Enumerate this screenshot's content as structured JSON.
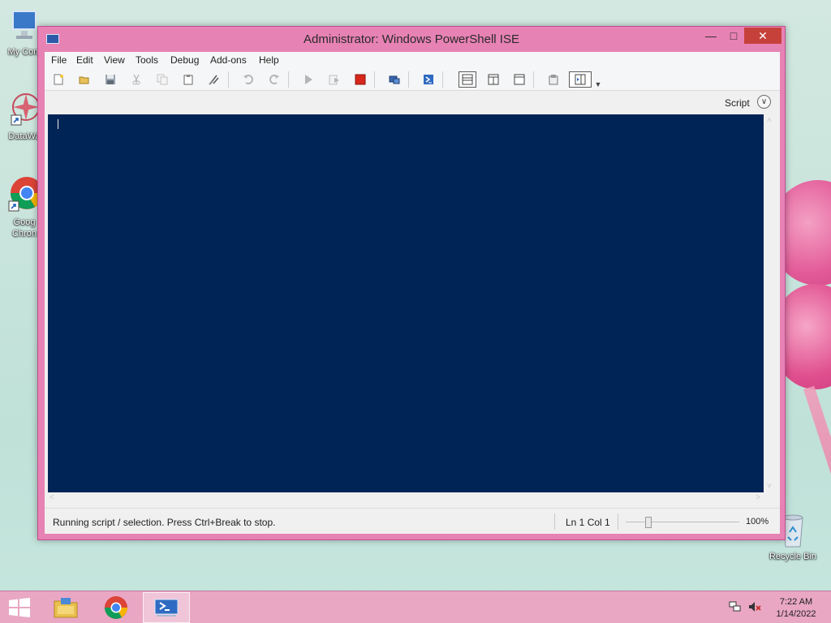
{
  "window": {
    "title": "Administrator: Windows PowerShell ISE",
    "controls": {
      "minimize": "—",
      "maximize": "□",
      "close": "✕"
    }
  },
  "menu": [
    "File",
    "Edit",
    "View",
    "Tools",
    "Debug",
    "Add-ons",
    "Help"
  ],
  "toolbar": {
    "icons": [
      "new-script-icon",
      "open-icon",
      "save-icon",
      "cut-icon",
      "copy-icon",
      "paste-icon",
      "clear-console-icon",
      "undo-icon",
      "redo-icon",
      "run-script-icon",
      "run-selection-icon",
      "stop-icon",
      "new-remote-tab-icon",
      "start-powershell-icon",
      "script-pane-top-icon",
      "script-pane-right-icon",
      "script-pane-maximized-icon",
      "show-commands-window-icon",
      "show-command-addon-icon",
      "overflow-icon"
    ]
  },
  "script_bar": {
    "label": "Script"
  },
  "console": {
    "text": ""
  },
  "status": {
    "message": "Running script / selection.  Press Ctrl+Break to stop.",
    "position": "Ln 1  Col 1",
    "zoom": "100%",
    "zoom_level": 0.2
  },
  "desktop_icons": [
    {
      "name": "my-computer",
      "label": "My Com"
    },
    {
      "name": "datawatch",
      "label": "DataWa"
    },
    {
      "name": "google-chrome",
      "label": "Goog\nChron"
    },
    {
      "name": "recycle-bin",
      "label": "Recycle Bin"
    }
  ],
  "taskbar": {
    "apps": [
      "file-explorer-icon",
      "chrome-icon",
      "powershell-ise-icon"
    ],
    "active_app": "powershell-ise-icon",
    "time": "7:22 AM",
    "date": "1/14/2022"
  },
  "colors": {
    "console_bg": "#012456",
    "window_frame": "#e782b4",
    "close_button": "#c7413b",
    "taskbar": "#e9a7c3"
  }
}
